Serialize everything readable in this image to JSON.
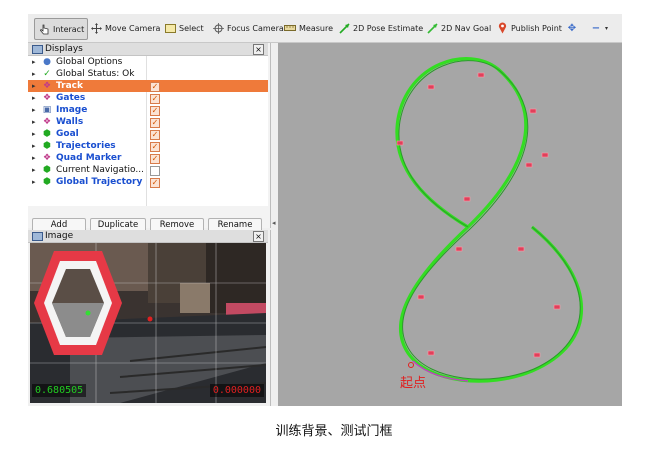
{
  "toolbar": {
    "items": [
      {
        "label": "Interact",
        "icon": "interact-icon"
      },
      {
        "label": "Move Camera",
        "icon": "move-camera-icon"
      },
      {
        "label": "Select",
        "icon": "select-icon"
      },
      {
        "label": "Focus Camera",
        "icon": "focus-camera-icon"
      },
      {
        "label": "Measure",
        "icon": "measure-icon"
      },
      {
        "label": "2D Pose Estimate",
        "icon": "pose-estimate-icon"
      },
      {
        "label": "2D Nav Goal",
        "icon": "nav-goal-icon"
      },
      {
        "label": "Publish Point",
        "icon": "publish-point-icon"
      }
    ]
  },
  "displays": {
    "title": "Displays",
    "items": [
      {
        "label": "Global Options",
        "icon": "globe-icon",
        "checked": null,
        "selected": false,
        "style": "black"
      },
      {
        "label": "Global Status: Ok",
        "icon": "check-icon",
        "checked": null,
        "selected": false,
        "style": "black"
      },
      {
        "label": "Track",
        "icon": "marker-icon",
        "checked": true,
        "selected": true,
        "style": "blue"
      },
      {
        "label": "Gates",
        "icon": "marker-icon",
        "checked": true,
        "selected": false,
        "style": "blue"
      },
      {
        "label": "Image",
        "icon": "image-icon",
        "checked": true,
        "selected": false,
        "style": "blue"
      },
      {
        "label": "Walls",
        "icon": "marker-icon",
        "checked": true,
        "selected": false,
        "style": "blue"
      },
      {
        "label": "Goal",
        "icon": "cube-icon",
        "checked": true,
        "selected": false,
        "style": "blue"
      },
      {
        "label": "Trajectories",
        "icon": "cube-icon",
        "checked": true,
        "selected": false,
        "style": "blue"
      },
      {
        "label": "Quad Marker",
        "icon": "marker-icon",
        "checked": true,
        "selected": false,
        "style": "blue"
      },
      {
        "label": "Current Navigatio...",
        "icon": "cube-icon",
        "checked": false,
        "selected": false,
        "style": "black"
      },
      {
        "label": "Global Trajectory",
        "icon": "cube-icon",
        "checked": true,
        "selected": false,
        "style": "blue"
      }
    ],
    "buttons": {
      "add": "Add",
      "duplicate": "Duplicate",
      "remove": "Remove",
      "rename": "Rename"
    }
  },
  "image_panel": {
    "title": "Image",
    "left_value": "0.680505",
    "right_value": "0.000000"
  },
  "view3d": {
    "start_label": "起点"
  },
  "caption": "训练背景、测试门框",
  "colors": {
    "selected_row": "#ef7a3a",
    "view_background": "#a6a6a6",
    "trajectory": "#33dd22",
    "gate": "#e0405a",
    "start_label": "#e02020",
    "left_value": "#22cc22",
    "right_value": "#e02020"
  }
}
